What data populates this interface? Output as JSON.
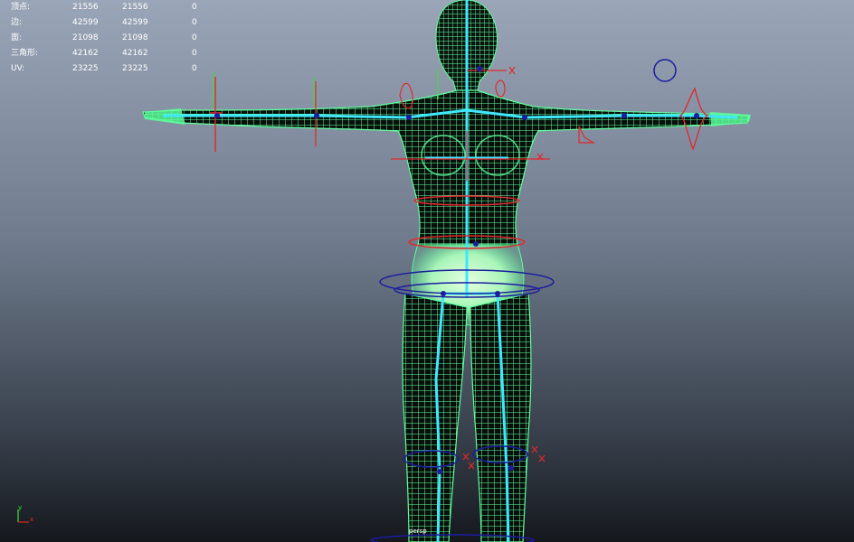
{
  "hud": {
    "rows": [
      {
        "label": "顶点:",
        "v1": "21556",
        "v2": "21556",
        "v3": "0"
      },
      {
        "label": "边:",
        "v1": "42599",
        "v2": "42599",
        "v3": "0"
      },
      {
        "label": "面:",
        "v1": "21098",
        "v2": "21098",
        "v3": "0"
      },
      {
        "label": "三角形:",
        "v1": "42162",
        "v2": "42162",
        "v3": "0"
      },
      {
        "label": "UV:",
        "v1": "23225",
        "v2": "23225",
        "v3": "0"
      }
    ]
  },
  "axis_gizmo": {
    "y_label": "y",
    "x_label": "x"
  },
  "camera_label": "persp",
  "colors": {
    "wire": "#5cff9c",
    "bone": "#3fe8ff",
    "control_red": "#e0282c",
    "control_blue": "#1c1ca0",
    "hud_text": "#ffffff"
  }
}
